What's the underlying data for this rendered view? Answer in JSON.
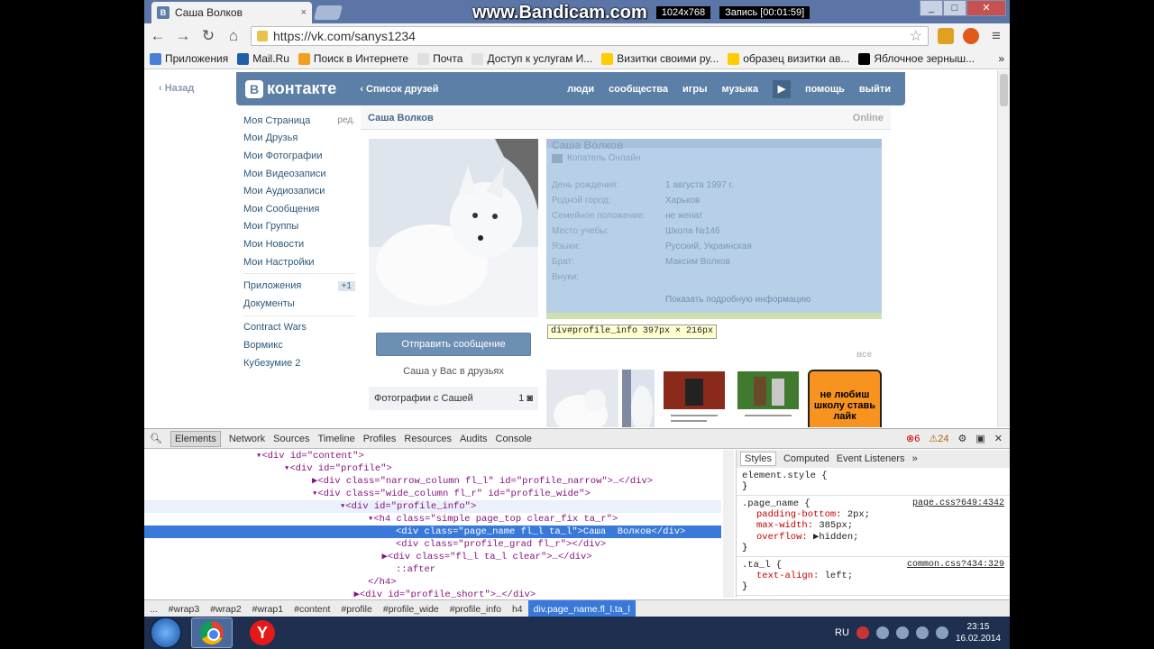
{
  "browser": {
    "tab_title": "Саша Волков",
    "tab_close": "×",
    "url": "https://vk.com/sanys1234",
    "bandicam_logo": "www.Bandicam.com",
    "bandicam_status": "Запись [00:01:59]",
    "bandicam_res": "1024x768",
    "bookmarks": [
      {
        "label": "Приложения",
        "color": "#4a7fd8"
      },
      {
        "label": "Mail.Ru",
        "color": "#1f5fa8"
      },
      {
        "label": "Поиск в Интернете",
        "color": "#f0a020"
      },
      {
        "label": "Почта",
        "color": "#e0e0e0"
      },
      {
        "label": "Доступ к услугам И...",
        "color": "#e0e0e0"
      },
      {
        "label": "Визитки своими ру...",
        "color": "#ffcc00"
      },
      {
        "label": "образец визитки ав...",
        "color": "#ffcc00"
      },
      {
        "label": "Яблочное зерныш...",
        "color": "#000000"
      }
    ],
    "more": "»"
  },
  "vk": {
    "back": "Назад",
    "logo": "контакте",
    "logo_b": "В",
    "friend_list": "Список друзей",
    "nav": [
      "люди",
      "сообщества",
      "игры",
      "музыка",
      "помощь",
      "выйти"
    ],
    "menu": [
      {
        "label": "Моя Страница",
        "side": "ред."
      },
      {
        "label": "Мои Друзья",
        "side": ""
      },
      {
        "label": "Мои Фотографии",
        "side": ""
      },
      {
        "label": "Мои Видеозаписи",
        "side": ""
      },
      {
        "label": "Мои Аудиозаписи",
        "side": ""
      },
      {
        "label": "Мои Сообщения",
        "side": ""
      },
      {
        "label": "Мои Группы",
        "side": ""
      },
      {
        "label": "Мои Новости",
        "side": ""
      },
      {
        "label": "Мои Настройки",
        "side": ""
      }
    ],
    "menu2": [
      {
        "label": "Приложения",
        "badge": "+1"
      },
      {
        "label": "Документы",
        "badge": ""
      }
    ],
    "menu3": [
      "Contract Wars",
      "Вормикс",
      "Кубезумие 2"
    ],
    "profile": {
      "name": "Саша Волков",
      "online": "Online",
      "status": "Копатель Онлайн",
      "send_message": "Отправить сообщение",
      "in_friends": "Саша у Вас в друзьях",
      "photos_with": "Фотографии с Сашей",
      "photos_count": "1",
      "show_full": "Показать подробную информацию",
      "all": "все",
      "info": [
        {
          "k": "День рождения:",
          "v": "1 августа 1997 г."
        },
        {
          "k": "Родной город:",
          "v": "Харьков"
        },
        {
          "k": "Семейное положение:",
          "v": "не женат"
        },
        {
          "k": "Место учебы:",
          "v": "Школа №146"
        },
        {
          "k": "Языки:",
          "v": "Русский, Украинская"
        },
        {
          "k": "Брат:",
          "v": "Максим Волков"
        },
        {
          "k": "Внуки:",
          "v": ""
        }
      ],
      "banner_text": "не любиш школу ставь лайк"
    },
    "tooltip": "div#profile_info 397px × 216px"
  },
  "devtools": {
    "tabs": [
      "Elements",
      "Network",
      "Sources",
      "Timeline",
      "Profiles",
      "Resources",
      "Audits",
      "Console"
    ],
    "errors": "6",
    "warnings": "24",
    "dom_lines": [
      {
        "indent": 8,
        "html": "▾<div id=\"content\">",
        "cls": ""
      },
      {
        "indent": 10,
        "html": "▾<div id=\"profile\">",
        "cls": ""
      },
      {
        "indent": 12,
        "html": "▶<div class=\"narrow_column fl_l\" id=\"profile_narrow\">…</div>",
        "cls": ""
      },
      {
        "indent": 12,
        "html": "▾<div class=\"wide_column fl_r\" id=\"profile_wide\">",
        "cls": ""
      },
      {
        "indent": 14,
        "html": "▾<div id=\"profile_info\">",
        "cls": "sh"
      },
      {
        "indent": 16,
        "html": "▾<h4 class=\"simple page_top clear_fix ta_r\">",
        "cls": ""
      },
      {
        "indent": 18,
        "html": "<div class=\"page_name fl_l ta_l\">Саша  Волков</div>",
        "cls": "hl"
      },
      {
        "indent": 18,
        "html": "<div class=\"profile_grad fl_r\"></div>",
        "cls": ""
      },
      {
        "indent": 17,
        "html": "▶<div class=\"fl_l ta_l clear\">…</div>",
        "cls": ""
      },
      {
        "indent": 18,
        "html": "::after",
        "cls": ""
      },
      {
        "indent": 16,
        "html": "</h4>",
        "cls": ""
      },
      {
        "indent": 15,
        "html": "▶<div id=\"profile_short\">…</div>",
        "cls": ""
      }
    ],
    "style_tabs": [
      "Styles",
      "Computed",
      "Event Listeners"
    ],
    "rules": [
      {
        "sel": "element.style {",
        "src": "",
        "props": []
      },
      {
        "sel": ".page_name {",
        "src": "page.css?649:4342",
        "props": [
          {
            "p": "padding-bottom",
            "v": "2px;"
          },
          {
            "p": "max-width",
            "v": "385px;"
          },
          {
            "p": "overflow",
            "v": "▶hidden;"
          }
        ]
      },
      {
        "sel": ".ta_l {",
        "src": "common.css?434:329",
        "props": [
          {
            "p": "text-align",
            "v": "left;"
          }
        ]
      }
    ],
    "crumbs": [
      "...",
      "#wrap3",
      "#wrap2",
      "#wrap1",
      "#content",
      "#profile",
      "#profile_wide",
      "#profile_info",
      "h4",
      "div.page_name.fl_l.ta_l"
    ]
  },
  "taskbar": {
    "lang": "RU",
    "time": "23:15",
    "date": "16.02.2014"
  }
}
